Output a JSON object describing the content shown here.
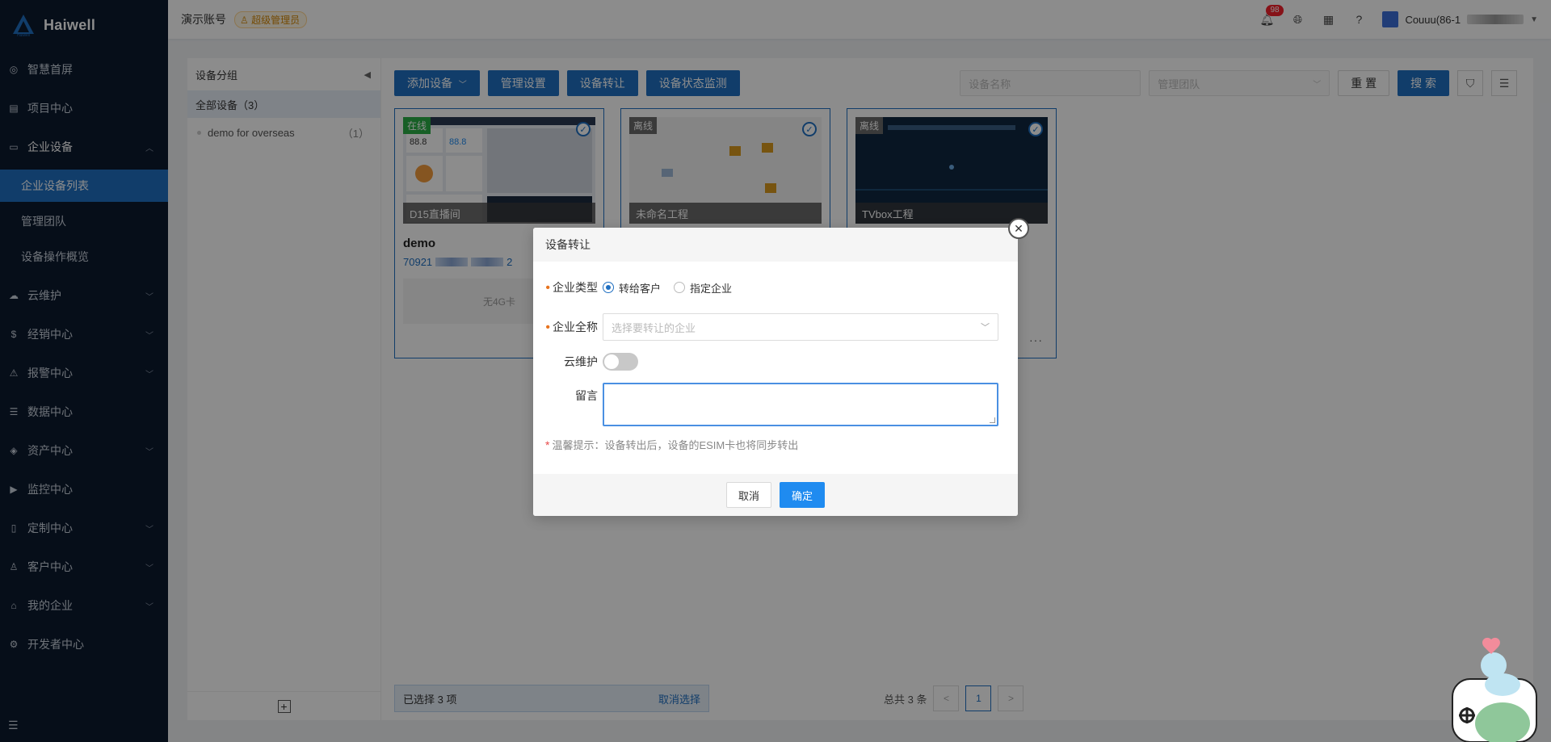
{
  "brand": {
    "name": "Haiwell",
    "logo_sub": "Haiwell"
  },
  "header": {
    "account": "演示账号",
    "role_badge": "超级管理员",
    "notification_count": "98",
    "user_name": "Couuu(86-1"
  },
  "sidebar": {
    "items": [
      {
        "label": "智慧首屏",
        "icon": "screen-icon"
      },
      {
        "label": "项目中心",
        "icon": "project-icon"
      },
      {
        "label": "企业设备",
        "icon": "device-icon",
        "expanded": true,
        "children": [
          {
            "label": "企业设备列表",
            "active": true
          },
          {
            "label": "管理团队"
          },
          {
            "label": "设备操作概览"
          }
        ]
      },
      {
        "label": "云维护",
        "icon": "cloud-icon",
        "has_children": true
      },
      {
        "label": "经销中心",
        "icon": "dollar-icon",
        "has_children": true
      },
      {
        "label": "报警中心",
        "icon": "alarm-icon",
        "has_children": true
      },
      {
        "label": "数据中心",
        "icon": "data-icon"
      },
      {
        "label": "资产中心",
        "icon": "asset-icon",
        "has_children": true
      },
      {
        "label": "监控中心",
        "icon": "camera-icon"
      },
      {
        "label": "定制中心",
        "icon": "custom-icon",
        "has_children": true
      },
      {
        "label": "客户中心",
        "icon": "customer-icon",
        "has_children": true
      },
      {
        "label": "我的企业",
        "icon": "home-icon",
        "has_children": true
      },
      {
        "label": "开发者中心",
        "icon": "developer-icon"
      }
    ]
  },
  "groups": {
    "title": "设备分组",
    "all_label": "全部设备（3）",
    "items": [
      {
        "label": "demo for overseas",
        "count": "（1）"
      }
    ]
  },
  "toolbar": {
    "add_device": "添加设备",
    "manage_settings": "管理设置",
    "device_transfer": "设备转让",
    "status_monitor": "设备状态监测",
    "device_name_placeholder": "设备名称",
    "team_placeholder": "管理团队",
    "reset": "重 置",
    "search": "搜 索"
  },
  "cards": [
    {
      "status": "在线",
      "status_type": "online",
      "thumb_title": "D15直播间",
      "name": "demo",
      "id_prefix": "70921",
      "id_suffix": "2",
      "sim": "无4G卡"
    },
    {
      "status": "离线",
      "status_type": "offline",
      "thumb_title": "未命名工程"
    },
    {
      "status": "离线",
      "status_type": "offline",
      "thumb_title": "TVbox工程"
    }
  ],
  "footer": {
    "selected": "已选择 3 项",
    "cancel_select": "取消选择",
    "total": "总共 3 条",
    "current_page": "1"
  },
  "modal": {
    "title": "设备转让",
    "company_type_label": "企业类型",
    "radio_customer": "转给客户",
    "radio_company": "指定企业",
    "company_name_label": "企业全称",
    "company_name_placeholder": "选择要转让的企业",
    "cloud_label": "云维护",
    "message_label": "留言",
    "tip": "温馨提示：设备转出后，设备的ESIM卡也将同步转出",
    "cancel": "取消",
    "confirm": "确定"
  },
  "colors": {
    "sidebar_bg": "#0c1a2f",
    "primary": "#1f6fc1",
    "online": "#2bae45",
    "offline": "#6b6b6b"
  }
}
